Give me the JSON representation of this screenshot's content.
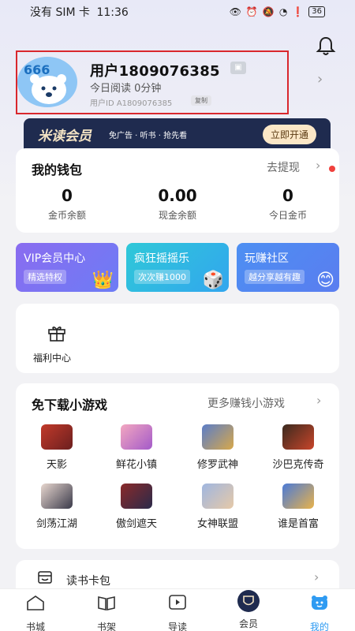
{
  "status_bar": {
    "carrier": "没有 SIM 卡",
    "time": "11:36",
    "battery": "36"
  },
  "profile": {
    "username": "用户1809076385",
    "read_time": "今日阅读 0分钟",
    "user_id": "用户ID A1809076385",
    "copy_label": "复制",
    "avatar_text": "666"
  },
  "vip_banner": {
    "title": "米读会员",
    "desc": "免广告 · 听书 · 抢先看",
    "button": "立即开通"
  },
  "wallet": {
    "title": "我的钱包",
    "withdraw": "去提现",
    "stats": [
      {
        "value": "0",
        "label": "金币余额"
      },
      {
        "value": "0.00",
        "label": "现金余额"
      },
      {
        "value": "0",
        "label": "今日金币"
      }
    ]
  },
  "tiles": [
    {
      "title": "VIP会员中心",
      "sub": "精选特权"
    },
    {
      "title": "疯狂摇摇乐",
      "sub": "次次赚1000"
    },
    {
      "title": "玩赚社区",
      "sub": "越分享越有趣"
    }
  ],
  "welfare": {
    "label": "福利中心"
  },
  "games": {
    "title": "免下载小游戏",
    "more": "更多赚钱小游戏",
    "items": [
      "天影",
      "鲜花小镇",
      "修罗武神",
      "沙巴克传奇",
      "剑荡江湖",
      "傲剑遮天",
      "女神联盟",
      "谁是首富"
    ]
  },
  "card_pack": {
    "label": "读书卡包"
  },
  "nav": [
    {
      "label": "书城"
    },
    {
      "label": "书架"
    },
    {
      "label": "导读"
    },
    {
      "label": "会员"
    },
    {
      "label": "我的"
    }
  ],
  "colors": {
    "accent": "#2f9bf2",
    "highlight_box": "#d9272d",
    "vip_dark": "#1f2b4f",
    "red_dot": "#f0413d"
  }
}
